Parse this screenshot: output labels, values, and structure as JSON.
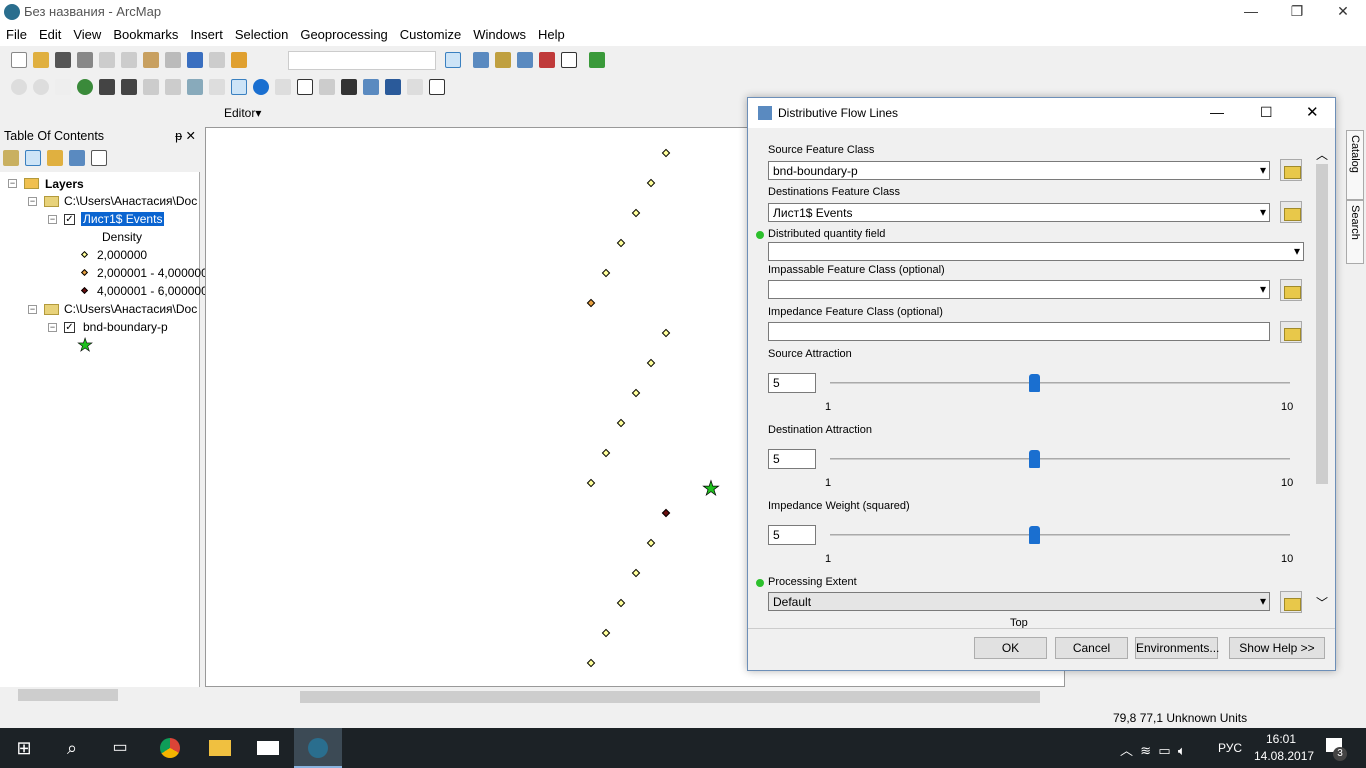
{
  "window": {
    "title": "Без названия - ArcMap"
  },
  "menu": [
    "File",
    "Edit",
    "View",
    "Bookmarks",
    "Insert",
    "Selection",
    "Geoprocessing",
    "Customize",
    "Windows",
    "Help"
  ],
  "toolbar": {
    "editor_label": "Editor▾"
  },
  "toc": {
    "title": "Table Of Contents",
    "root": "Layers",
    "group1": "C:\\Users\\Анастасия\\Doc",
    "layer1": "Лист1$ Events",
    "field": "Density",
    "classes": [
      {
        "label": "2,000000",
        "color": "#ffff99"
      },
      {
        "label": "2,000001 - 4,000000",
        "color": "#e8a040"
      },
      {
        "label": "4,000001 - 6,000000",
        "color": "#6b0f0f"
      }
    ],
    "group2": "C:\\Users\\Анастасия\\Doc",
    "layer2": "bnd-boundary-p"
  },
  "side_tabs": [
    "Catalog",
    "Search"
  ],
  "dialog": {
    "title": "Distributive Flow Lines",
    "source_label": "Source Feature Class",
    "source_value": "bnd-boundary-p",
    "dest_label": "Destinations Feature Class",
    "dest_value": "Лист1$ Events",
    "qty_label": "Distributed quantity field",
    "qty_value": "",
    "imp_label": "Impassable Feature Class (optional)",
    "imp_value": "",
    "impd_label": "Impedance Feature Class (optional)",
    "impd_value": "",
    "sliders": [
      {
        "label": "Source Attraction",
        "value": "5",
        "min": "1",
        "max": "10"
      },
      {
        "label": "Destination Attraction",
        "value": "5",
        "min": "1",
        "max": "10"
      },
      {
        "label": "Impedance Weight (squared)",
        "value": "5",
        "min": "1",
        "max": "10"
      }
    ],
    "extent_label": "Processing Extent",
    "extent_value": "Default",
    "extent_top": "Top",
    "ok": "OK",
    "cancel": "Cancel",
    "env": "Environments...",
    "help": "Show Help >>"
  },
  "status": {
    "coords": "79,8  77,1 Unknown Units"
  },
  "tray": {
    "lang": "РУС",
    "time": "16:01",
    "date": "14.08.2017",
    "notifications": "3"
  }
}
